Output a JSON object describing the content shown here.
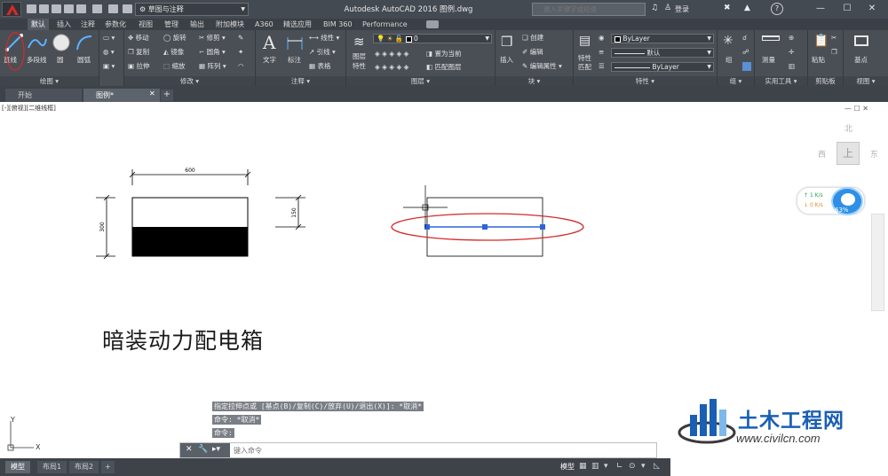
{
  "title_bar": {
    "workspace": "草图与注释",
    "title": "Autodesk AutoCAD 2016    图例.dwg",
    "search_placeholder": "键入关键字或短语",
    "login": "登录",
    "help": "?"
  },
  "ribbon_tabs": [
    "默认",
    "插入",
    "注释",
    "参数化",
    "视图",
    "管理",
    "输出",
    "附加模块",
    "A360",
    "精选应用",
    "BIM 360",
    "Performance"
  ],
  "ribbon": {
    "draw": {
      "line": "直线",
      "polyline": "多段线",
      "circle": "圆",
      "arc": "圆弧",
      "footer": "绘图 ▾"
    },
    "modify": {
      "move": "移动",
      "rotate": "旋转",
      "trim": "修剪",
      "copy": "复制",
      "mirror": "镜像",
      "fillet": "圆角",
      "stretch": "拉伸",
      "scale": "缩放",
      "array": "阵列",
      "footer": "修改 ▾"
    },
    "annotation": {
      "text": "文字",
      "dimension": "标注",
      "linear": "线性",
      "leader": "引线",
      "table": "表格",
      "footer": "注释 ▾"
    },
    "layers": {
      "layer_props_1": "图层",
      "layer_props_2": "特性",
      "current_layer": "0",
      "set_current": "置为当前",
      "match_layer": "匹配图层",
      "footer": "图层 ▾"
    },
    "block": {
      "insert": "插入",
      "create": "创建",
      "edit": "编辑",
      "edit_attr": "编辑属性",
      "footer": "块 ▾"
    },
    "properties": {
      "match_1": "特性",
      "match_2": "匹配",
      "color": "ByLayer",
      "linetype": "默认",
      "lineweight": "ByLayer",
      "footer": "特性 ▾"
    },
    "groups": {
      "group": "组",
      "footer": "组 ▾"
    },
    "utilities": {
      "measure": "测量",
      "footer": "实用工具 ▾"
    },
    "clipboard": {
      "paste": "粘贴",
      "footer": "剪贴板"
    },
    "view": {
      "base": "基点",
      "footer": "视图 ▾"
    }
  },
  "file_tabs": [
    "开始",
    "图例*"
  ],
  "viewport": {
    "label": "[-][俯视][二维线框]",
    "viewcube": {
      "north": "北",
      "west": "西",
      "east": "东",
      "face": "上"
    },
    "netspeed": {
      "up": "1  K/s",
      "down": "0  K/s",
      "percent": "63%"
    },
    "dims": {
      "width": "600",
      "height": "300",
      "half": "150"
    },
    "big_title": "暗装动力配电箱",
    "ucs_x": "X",
    "ucs_y": "Y"
  },
  "command": {
    "history": [
      "指定拉伸点或 [基点(B)/复制(C)/放弃(U)/退出(X)]: *取消*",
      "命令: *取消*",
      "命令:"
    ],
    "placeholder": "键入命令"
  },
  "status": {
    "tabs": [
      "模型",
      "布局1",
      "布局2"
    ],
    "model_button": "模型"
  },
  "watermark": {
    "text": "土木工程网",
    "url": "www.civilcn.com"
  },
  "colors": {
    "ribbon_bg": "#4a4f56",
    "highlight_red": "#d42a2a",
    "grip_blue": "#2f63d6",
    "brand_blue": "#1a5fb4"
  }
}
